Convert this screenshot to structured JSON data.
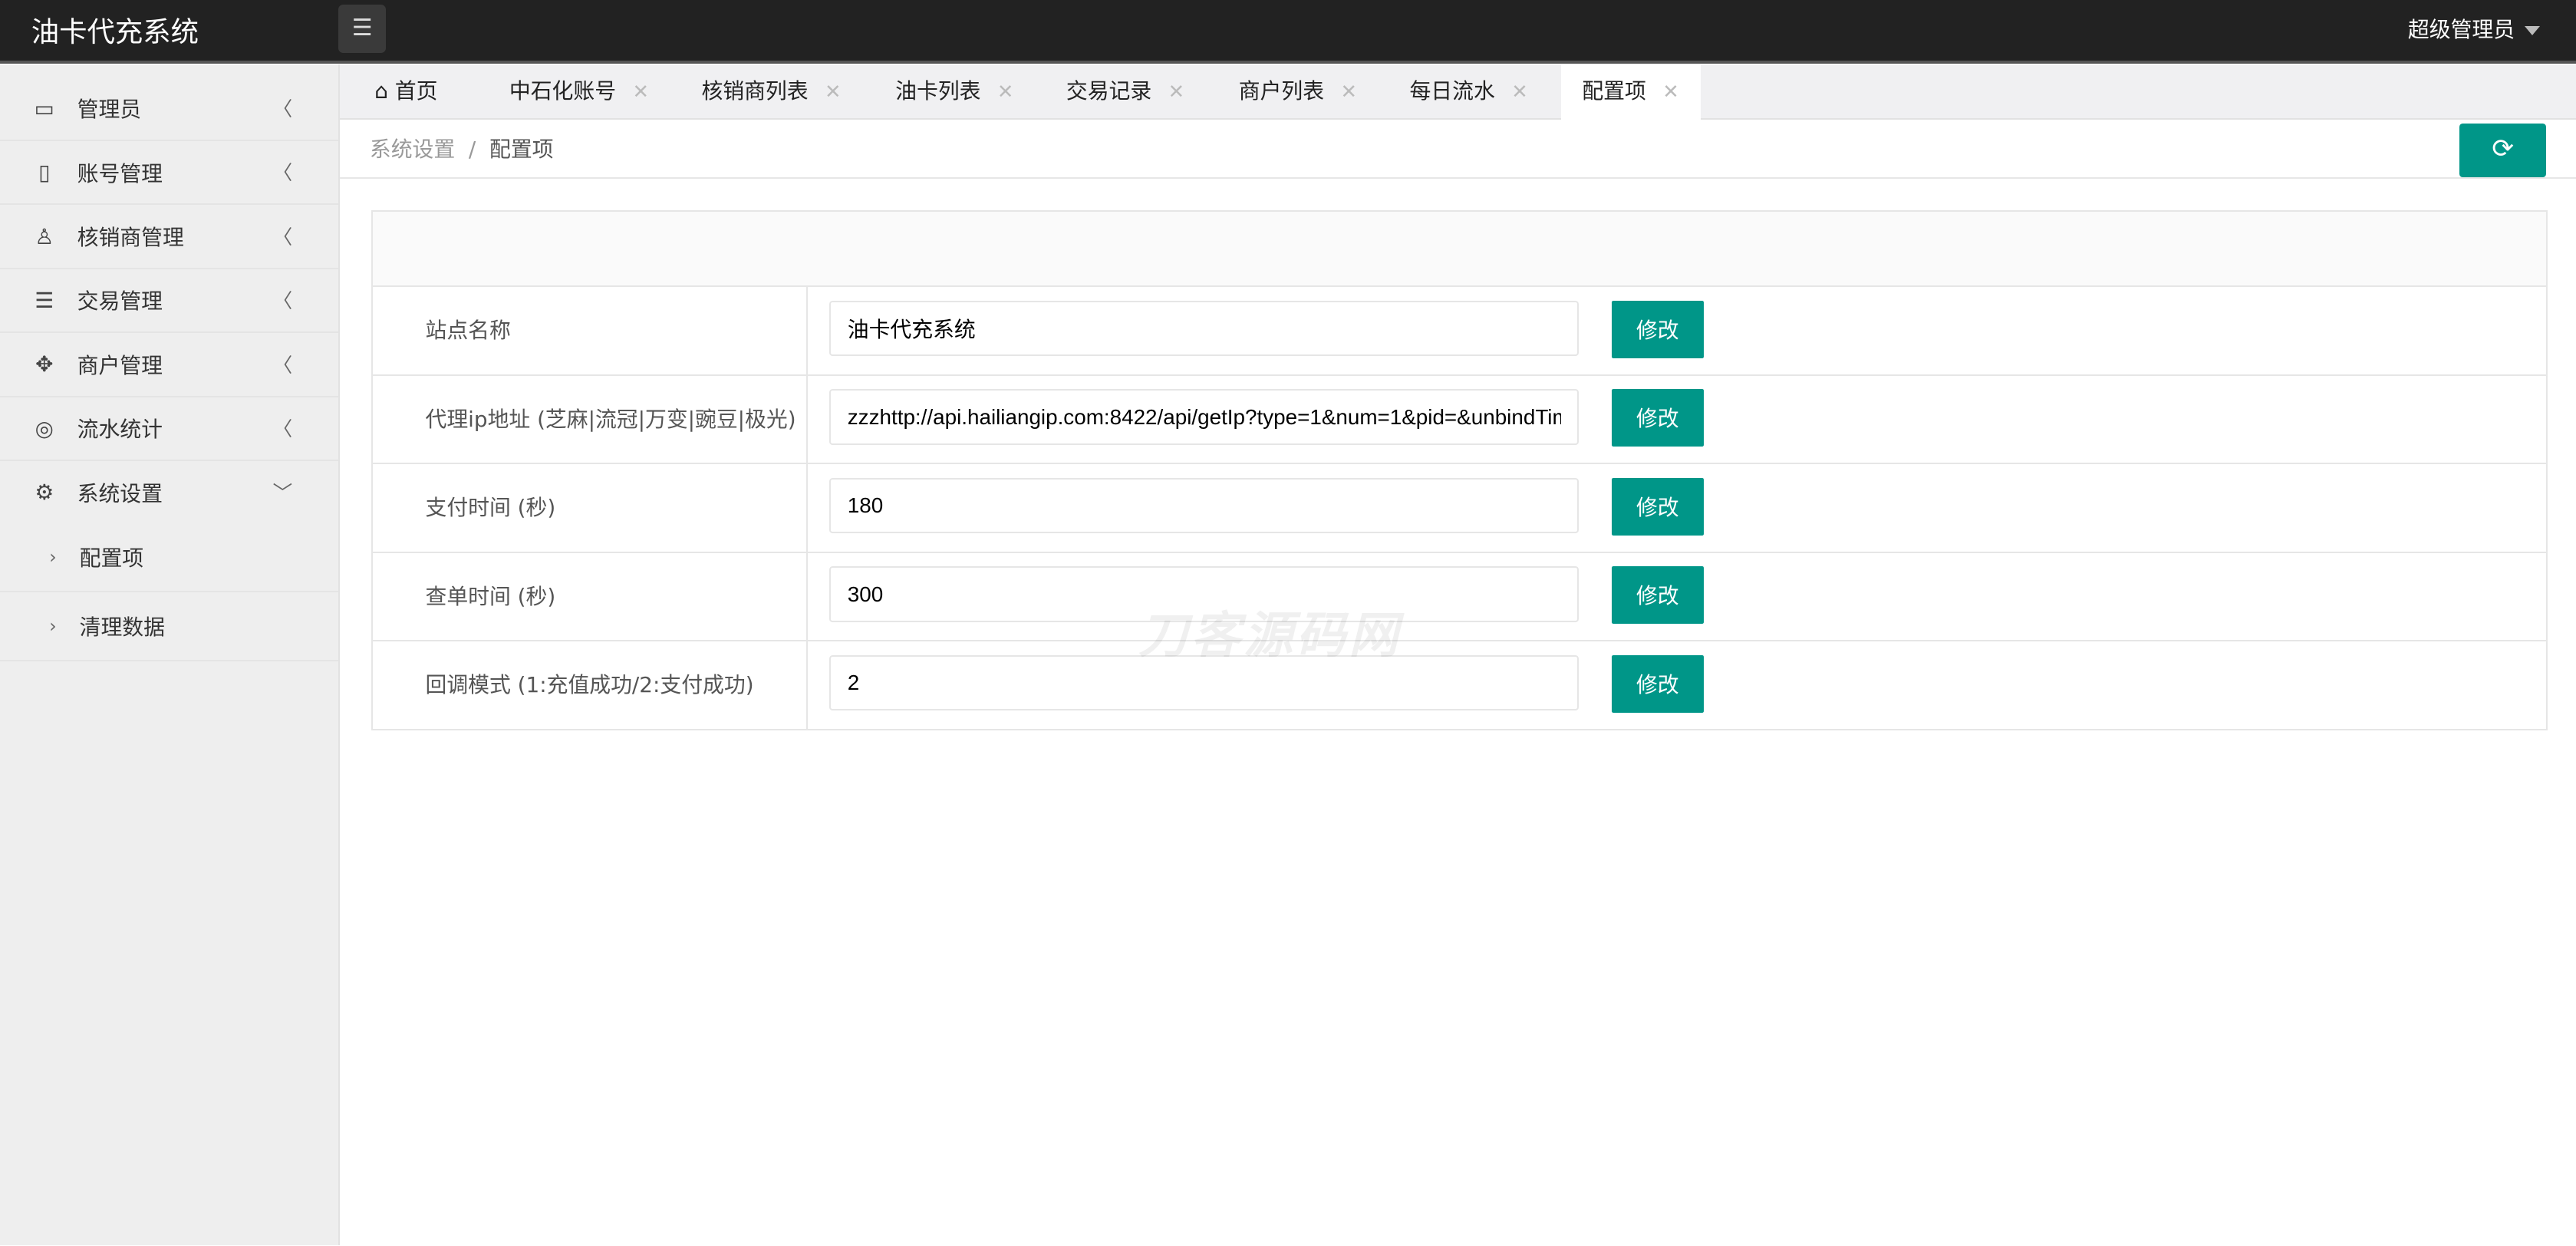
{
  "app": {
    "title": "油卡代充系统",
    "user": "超级管理员"
  },
  "sidebar": {
    "items": [
      {
        "label": "管理员",
        "icon": "id-card-icon"
      },
      {
        "label": "账号管理",
        "icon": "phone-icon"
      },
      {
        "label": "核销商管理",
        "icon": "user-icon"
      },
      {
        "label": "交易管理",
        "icon": "database-icon"
      },
      {
        "label": "商户管理",
        "icon": "handshake-icon"
      },
      {
        "label": "流水统计",
        "icon": "clock-icon"
      },
      {
        "label": "系统设置",
        "icon": "gear-icon"
      }
    ],
    "subitems": [
      {
        "label": "配置项"
      },
      {
        "label": "清理数据"
      }
    ]
  },
  "tabs": [
    {
      "label": "首页"
    },
    {
      "label": "中石化账号"
    },
    {
      "label": "核销商列表"
    },
    {
      "label": "油卡列表"
    },
    {
      "label": "交易记录"
    },
    {
      "label": "商户列表"
    },
    {
      "label": "每日流水"
    },
    {
      "label": "配置项",
      "active": true
    }
  ],
  "breadcrumb": {
    "parent": "系统设置",
    "sep": "/",
    "current": "配置项"
  },
  "config": {
    "button_label": "修改",
    "rows": [
      {
        "label": "站点名称",
        "value": "油卡代充系统"
      },
      {
        "label": "代理ip地址 (芝麻|流冠|万变|豌豆|极光)",
        "value": "zzzhttp://api.hailiangip.com:8422/api/getIp?type=1&num=1&pid=&unbindTim"
      },
      {
        "label": "支付时间 (秒)",
        "value": "180"
      },
      {
        "label": "查单时间 (秒)",
        "value": "300"
      },
      {
        "label": "回调模式 (1:充值成功/2:支付成功)",
        "value": "2"
      }
    ]
  },
  "watermark": "刀客源码网",
  "colors": {
    "accent": "#009688",
    "header": "#222222",
    "sidebar": "#eeeeee"
  }
}
